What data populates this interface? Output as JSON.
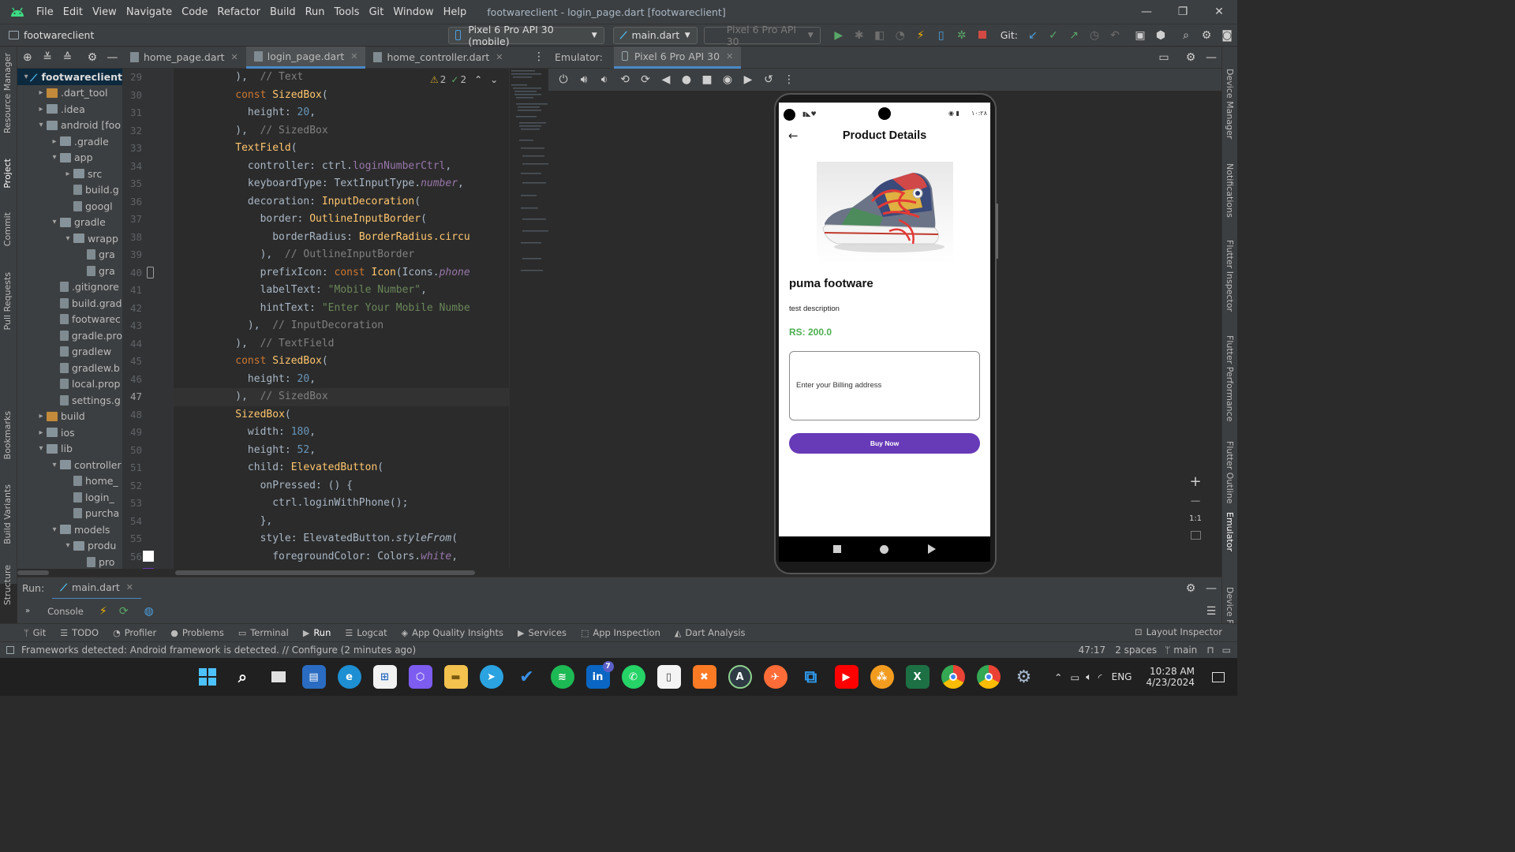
{
  "titlebar": {
    "menu": [
      "File",
      "Edit",
      "View",
      "Navigate",
      "Code",
      "Refactor",
      "Build",
      "Run",
      "Tools",
      "Git",
      "Window",
      "Help"
    ],
    "title": "footwareclient - login_page.dart [footwareclient]"
  },
  "navbar": {
    "project": "footwareclient",
    "device": "Pixel 6 Pro API 30 (mobile)",
    "run_config": "main.dart",
    "device_dim": "Pixel 6 Pro API 30",
    "git_label": "Git:"
  },
  "project_tree": [
    {
      "label": "footwareclient",
      "bold": true,
      "indent": 0,
      "arrow": "▾",
      "kind": "root"
    },
    {
      "label": ".dart_tool",
      "indent": 1,
      "arrow": "▸",
      "kind": "folder-orange"
    },
    {
      "label": ".idea",
      "indent": 1,
      "arrow": "▸",
      "kind": "folder"
    },
    {
      "label": "android [foo",
      "indent": 1,
      "arrow": "▾",
      "kind": "folder"
    },
    {
      "label": ".gradle",
      "indent": 2,
      "arrow": "▸",
      "kind": "folder"
    },
    {
      "label": "app",
      "indent": 2,
      "arrow": "▾",
      "kind": "folder"
    },
    {
      "label": "src",
      "indent": 3,
      "arrow": "▸",
      "kind": "folder"
    },
    {
      "label": "build.g",
      "indent": 3,
      "arrow": "",
      "kind": "file"
    },
    {
      "label": "googl",
      "indent": 3,
      "arrow": "",
      "kind": "file"
    },
    {
      "label": "gradle",
      "indent": 2,
      "arrow": "▾",
      "kind": "folder"
    },
    {
      "label": "wrapp",
      "indent": 3,
      "arrow": "▾",
      "kind": "folder"
    },
    {
      "label": "gra",
      "indent": 4,
      "arrow": "",
      "kind": "file"
    },
    {
      "label": "gra",
      "indent": 4,
      "arrow": "",
      "kind": "file"
    },
    {
      "label": ".gitignore",
      "indent": 2,
      "arrow": "",
      "kind": "file"
    },
    {
      "label": "build.grad",
      "indent": 2,
      "arrow": "",
      "kind": "file"
    },
    {
      "label": "footwarec",
      "indent": 2,
      "arrow": "",
      "kind": "file"
    },
    {
      "label": "gradle.pro",
      "indent": 2,
      "arrow": "",
      "kind": "file"
    },
    {
      "label": "gradlew",
      "indent": 2,
      "arrow": "",
      "kind": "file"
    },
    {
      "label": "gradlew.b",
      "indent": 2,
      "arrow": "",
      "kind": "file"
    },
    {
      "label": "local.prop",
      "indent": 2,
      "arrow": "",
      "kind": "file"
    },
    {
      "label": "settings.g",
      "indent": 2,
      "arrow": "",
      "kind": "file"
    },
    {
      "label": "build",
      "indent": 1,
      "arrow": "▸",
      "kind": "folder-orange"
    },
    {
      "label": "ios",
      "indent": 1,
      "arrow": "▸",
      "kind": "folder"
    },
    {
      "label": "lib",
      "indent": 1,
      "arrow": "▾",
      "kind": "folder"
    },
    {
      "label": "controller",
      "indent": 2,
      "arrow": "▾",
      "kind": "folder"
    },
    {
      "label": "home_",
      "indent": 3,
      "arrow": "",
      "kind": "file"
    },
    {
      "label": "login_",
      "indent": 3,
      "arrow": "",
      "kind": "file"
    },
    {
      "label": "purcha",
      "indent": 3,
      "arrow": "",
      "kind": "file"
    },
    {
      "label": "models",
      "indent": 2,
      "arrow": "▾",
      "kind": "folder"
    },
    {
      "label": "produ",
      "indent": 3,
      "arrow": "▾",
      "kind": "folder"
    },
    {
      "label": "pro",
      "indent": 4,
      "arrow": "",
      "kind": "file"
    },
    {
      "label": "pro",
      "indent": 4,
      "arrow": "",
      "kind": "file"
    }
  ],
  "editor_tabs": [
    {
      "label": "home_page.dart",
      "active": false
    },
    {
      "label": "login_page.dart",
      "active": true
    },
    {
      "label": "home_controller.dart",
      "active": false
    }
  ],
  "inspection": {
    "warnings": "2",
    "ok": "2"
  },
  "code_lines": [
    {
      "n": "29",
      "html": "<span>          ),  </span><span class=\"cmt\">// Text</span>"
    },
    {
      "n": "30",
      "html": "<span>          </span><span class=\"kw\">const </span><span class=\"cls\">SizedBox</span><span>(</span>"
    },
    {
      "n": "31",
      "html": "<span>            height: </span><span class=\"num\">20</span><span>,</span>"
    },
    {
      "n": "32",
      "html": "<span>          ),  </span><span class=\"cmt\">// SizedBox</span>"
    },
    {
      "n": "33",
      "html": "<span>          </span><span class=\"cls\">TextField</span><span>(</span>"
    },
    {
      "n": "34",
      "html": "<span>            controller: ctrl.</span><span class=\"prop\">loginNumberCtrl</span><span>,</span>"
    },
    {
      "n": "35",
      "html": "<span>            keyboardType: TextInputType.</span><span class=\"prop it\">number</span><span>,</span>"
    },
    {
      "n": "36",
      "html": "<span>            decoration: </span><span class=\"cls\">InputDecoration</span><span>(</span>"
    },
    {
      "n": "37",
      "html": "<span>              border: </span><span class=\"cls\">OutlineInputBorder</span><span>(</span>"
    },
    {
      "n": "38",
      "html": "<span>                borderRadius: </span><span class=\"cls\">BorderRadius.circu</span>"
    },
    {
      "n": "39",
      "html": "<span>              ),  </span><span class=\"cmt\">// OutlineInputBorder</span>"
    },
    {
      "n": "40",
      "html": "<span>              prefixIcon: </span><span class=\"kw\">const </span><span class=\"cls\">Icon</span><span>(Icons.</span><span class=\"prop it\">phone</span>"
    },
    {
      "n": "41",
      "html": "<span>              labelText: </span><span class=\"str\">\"Mobile Number\"</span><span>,</span>"
    },
    {
      "n": "42",
      "html": "<span>              hintText: </span><span class=\"str\">\"Enter Your Mobile Numbe</span>"
    },
    {
      "n": "43",
      "html": "<span>            ),  </span><span class=\"cmt\">// InputDecoration</span>"
    },
    {
      "n": "44",
      "html": "<span>          ),  </span><span class=\"cmt\">// TextField</span>"
    },
    {
      "n": "45",
      "html": "<span>          </span><span class=\"kw\">const </span><span class=\"cls\">SizedBox</span><span>(</span>"
    },
    {
      "n": "46",
      "html": "<span>            height: </span><span class=\"num\">20</span><span>,</span>"
    },
    {
      "n": "47",
      "html": "<span>          ),  </span><span class=\"cmt\">// SizedBox</span>",
      "current": true
    },
    {
      "n": "48",
      "html": "<span>          </span><span class=\"cls\">SizedBox</span><span>(</span>"
    },
    {
      "n": "49",
      "html": "<span>            width: </span><span class=\"num\">180</span><span>,</span>"
    },
    {
      "n": "50",
      "html": "<span>            height: </span><span class=\"num\">52</span><span>,</span>"
    },
    {
      "n": "51",
      "html": "<span>            child: </span><span class=\"cls\">ElevatedButton</span><span>(</span>"
    },
    {
      "n": "52",
      "html": "<span>              onPressed: () {</span>"
    },
    {
      "n": "53",
      "html": "<span>                ctrl.loginWithPhone();</span>"
    },
    {
      "n": "54",
      "html": "<span>              },</span>"
    },
    {
      "n": "55",
      "html": "<span>              style: ElevatedButton.</span><span class=\"it\">styleFrom</span><span>(</span>"
    },
    {
      "n": "56",
      "html": "<span>                foregroundColor: Colors.</span><span class=\"prop it\">white</span><span>,</span>"
    },
    {
      "n": "57",
      "html": "<span>                backgroundColor: Colors.</span><span class=\"prop it\">deepPu</span>"
    }
  ],
  "emulator": {
    "label": "Emulator:",
    "tab": "Pixel 6 Pro API 30",
    "status_time": "۱۰:۲۸",
    "zoom_reset": "1:1"
  },
  "app": {
    "appbar_title": "Product Details",
    "product_name": "puma footware",
    "description": "test description",
    "price": "RS: 200.0",
    "address_placeholder": "Enter your Billing address",
    "buy_label": "Buy Now",
    "accent": "#673ab7",
    "price_color": "#4caf50"
  },
  "run": {
    "label": "Run:",
    "tab": "main.dart",
    "console": "Console"
  },
  "tool_windows": [
    "Git",
    "TODO",
    "Profiler",
    "Problems",
    "Terminal",
    "Run",
    "Logcat",
    "App Quality Insights",
    "Services",
    "App Inspection",
    "Dart Analysis"
  ],
  "layout_inspector": "Layout Inspector",
  "status": {
    "message": "Frameworks detected: Android framework is detected. // Configure (2 minutes ago)",
    "position": "47:17",
    "indent": "2 spaces",
    "branch": "main"
  },
  "left_strip": [
    "Resource Manager",
    "Project",
    "Commit",
    "Pull Requests",
    "Bookmarks",
    "Build Variants",
    "Structure"
  ],
  "right_strip": [
    "Device Manager",
    "Notifications",
    "Flutter Inspector",
    "Flutter Performance",
    "Flutter Outline",
    "Emulator",
    "Device F"
  ],
  "taskbar": {
    "language": "ENG",
    "time": "10:28 AM",
    "date": "4/23/2024",
    "linkedin_badge": "7"
  }
}
